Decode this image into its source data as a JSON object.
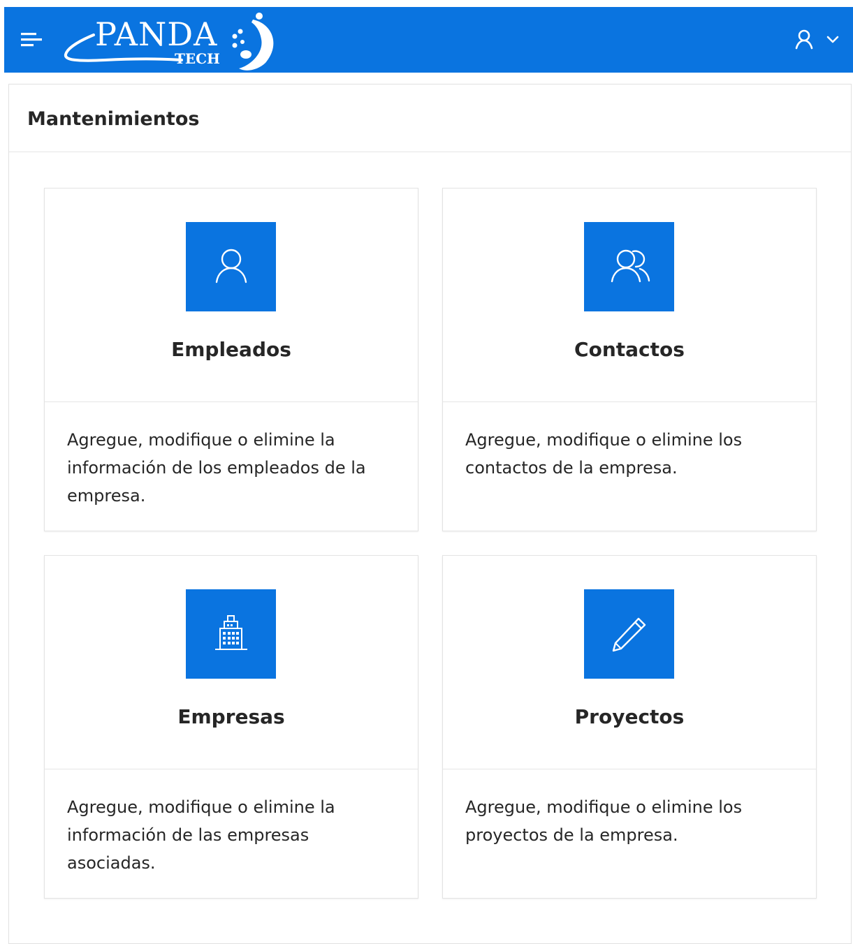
{
  "header": {
    "logo_text": "PANDA",
    "logo_sub": "TECH",
    "menu_icon": "hamburger-menu-icon",
    "user_icon": "user-icon",
    "dropdown_icon": "chevron-down-icon",
    "color": "#0a74e0"
  },
  "region": {
    "title": "Mantenimientos"
  },
  "cards": [
    {
      "icon": "user-icon",
      "title": "Empleados",
      "description": "Agregue, modifique o elimine la información de los empleados de la empresa."
    },
    {
      "icon": "users-icon",
      "title": "Contactos",
      "description": "Agregue, modifique o elimine los contactos de la empresa."
    },
    {
      "icon": "building-icon",
      "title": "Empresas",
      "description": "Agregue, modifique o elimine la información de las empresas asociadas."
    },
    {
      "icon": "pencil-icon",
      "title": "Proyectos",
      "description": "Agregue, modifique o elimine los proyectos de la empresa."
    }
  ]
}
